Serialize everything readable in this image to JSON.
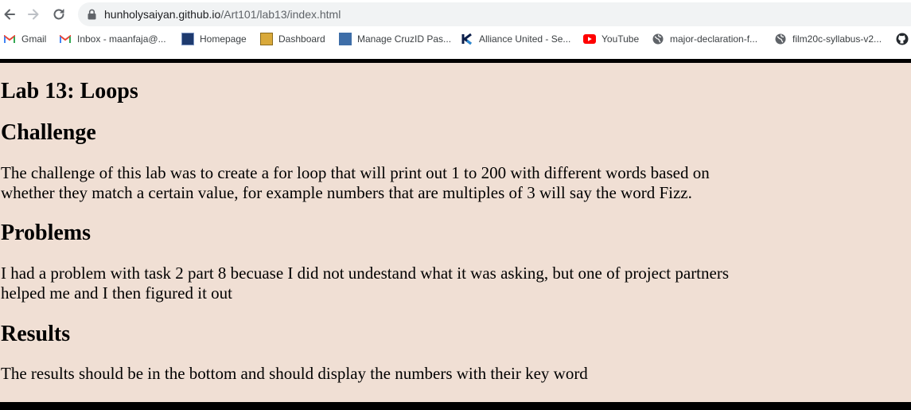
{
  "browser": {
    "url_host": "hunholysaiyan.github.io",
    "url_path": "/Art101/lab13/index.html",
    "bookmarks": [
      {
        "label": "Gmail",
        "icon": "gmail-icon"
      },
      {
        "label": "Inbox - maanfaja@...",
        "icon": "gmail-icon"
      },
      {
        "label": "Homepage",
        "icon": "ucsc-icon"
      },
      {
        "label": "Dashboard",
        "icon": "ucsc-icon"
      },
      {
        "label": "Manage CruzID Pas...",
        "icon": "its-icon"
      },
      {
        "label": "Alliance United - Se...",
        "icon": "k-icon"
      },
      {
        "label": "YouTube",
        "icon": "youtube-icon"
      },
      {
        "label": "major-declaration-f...",
        "icon": "globe-icon"
      },
      {
        "label": "film20c-syllabus-v2...",
        "icon": "globe-icon"
      }
    ]
  },
  "page": {
    "title": "Lab 13: Loops",
    "sections": [
      {
        "heading": "Challenge",
        "text": "The challenge of this lab was to create a for loop that will print out 1 to 200 with different words based on whether they match a certain value, for example numbers that are multiples of 3 will say the word Fizz."
      },
      {
        "heading": "Problems",
        "text": "I had a problem with task 2 part 8 becuase I did not undestand what it was asking, but one of project partners helped me and I then figured it out"
      },
      {
        "heading": "Results",
        "text": "The results should be in the bottom and should display the numbers with their key word"
      }
    ]
  },
  "colors": {
    "page_background": "#f0dfd4",
    "border": "#000000",
    "omnibox": "#f1f3f4"
  }
}
